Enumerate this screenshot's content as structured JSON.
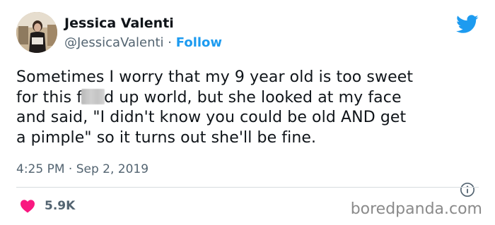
{
  "user": {
    "name": "Jessica Valenti",
    "handle": "@JessicaValenti",
    "separator": "·",
    "follow_label": "Follow"
  },
  "tweet": {
    "lines": [
      "Sometimes I worry that my 9 year old is too sweet",
      "for this f",
      "d up world, but she looked at my face",
      "and said, \"I didn't know you could be old AND get",
      "a pimple\" so it turns out she'll be fine."
    ],
    "time": "4:25 PM",
    "date": "Sep 2, 2019",
    "separator": "·"
  },
  "actions": {
    "like_count": "5.9K"
  },
  "watermark": "boredpanda.com",
  "colors": {
    "brand_blue": "#1d9bf0",
    "heart_red": "#f91880",
    "text_primary": "#0f1419",
    "text_secondary": "#536471"
  },
  "icons": {
    "brand": "twitter-bird-icon",
    "info": "info-icon",
    "like": "heart-icon"
  }
}
